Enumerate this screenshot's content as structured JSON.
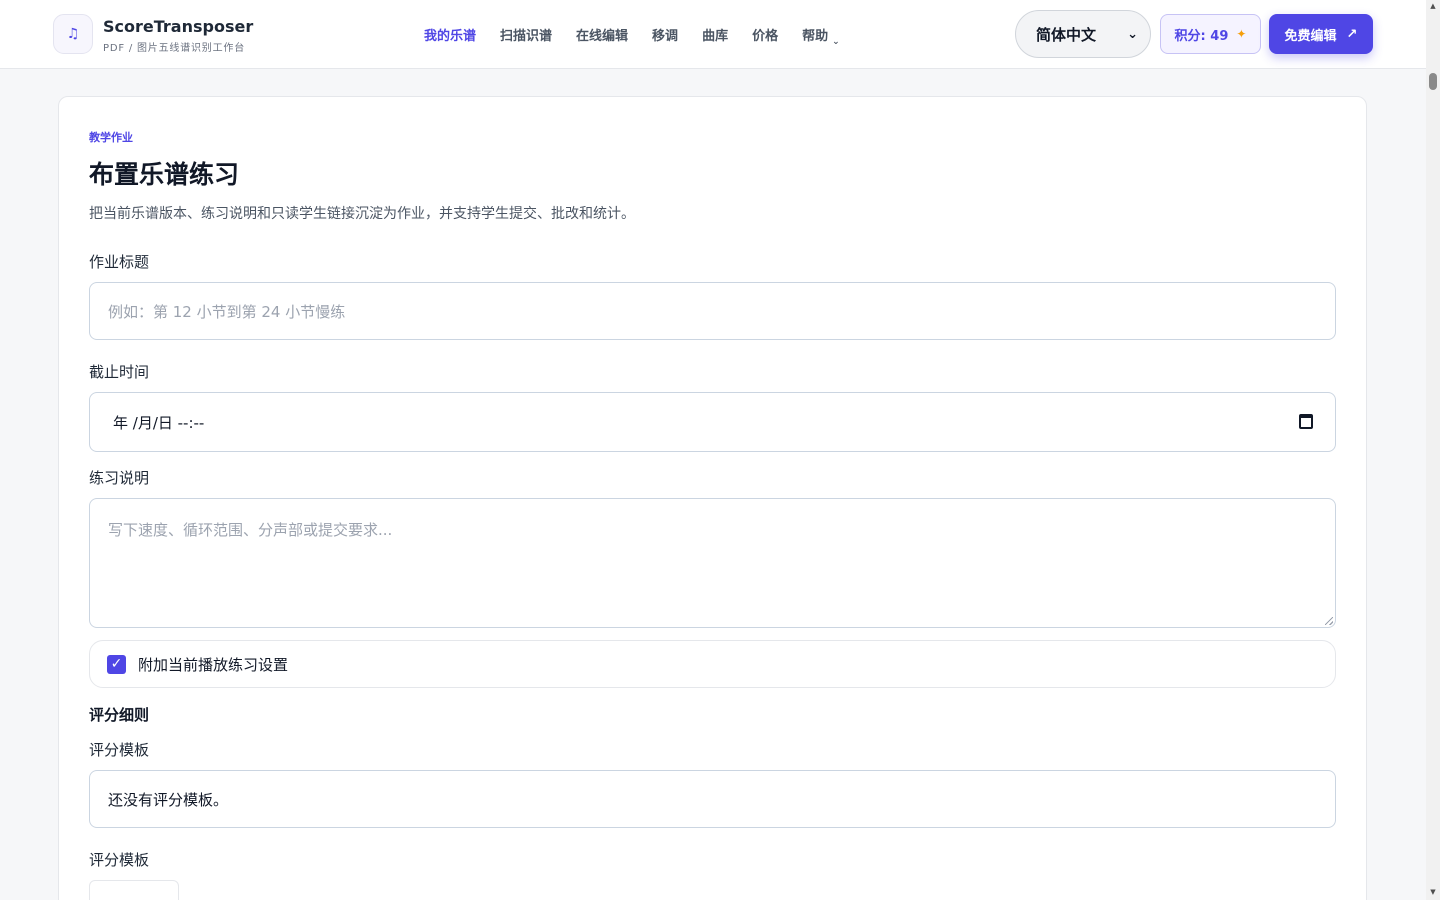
{
  "header": {
    "logo_glyph": "♫",
    "brand_name": "ScoreTransposer",
    "brand_sub": "PDF / 图片五线谱识别工作台",
    "nav": [
      {
        "label": "我的乐谱",
        "active": true
      },
      {
        "label": "扫描识谱"
      },
      {
        "label": "在线编辑"
      },
      {
        "label": "移调"
      },
      {
        "label": "曲库"
      },
      {
        "label": "价格"
      },
      {
        "label": "帮助"
      }
    ],
    "help_chevron": "⌄",
    "language": "简体中文",
    "language_chevron": "⌄",
    "points_label": "积分: 49",
    "points_icon": "✦",
    "edit_label": "免费编辑",
    "edit_icon": "↗"
  },
  "colors": {
    "accent": "#4f46e5",
    "spark": "#f59e0b"
  },
  "form": {
    "eyebrow": "教学作业",
    "title": "布置乐谱练习",
    "description": "把当前乐谱版本、练习说明和只读学生链接沉淀为作业，并支持学生提交、批改和统计。",
    "title_label": "作业标题",
    "title_placeholder": "例如：第 12 小节到第 24 小节慢练",
    "deadline_label": "截止时间",
    "deadline_value": "年 /月/日 --:--",
    "notes_label": "练习说明",
    "notes_placeholder": "写下速度、循环范围、分声部或提交要求...",
    "attach_checked": true,
    "attach_label": "附加当前播放练习设置",
    "rubric_heading": "评分细则",
    "rubric_template_label": "评分模板",
    "rubric_template_empty": "还没有评分模板。",
    "rubric_template_label_2": "评分模板"
  },
  "scrollbar": {
    "up": "▲",
    "down": "▼"
  }
}
